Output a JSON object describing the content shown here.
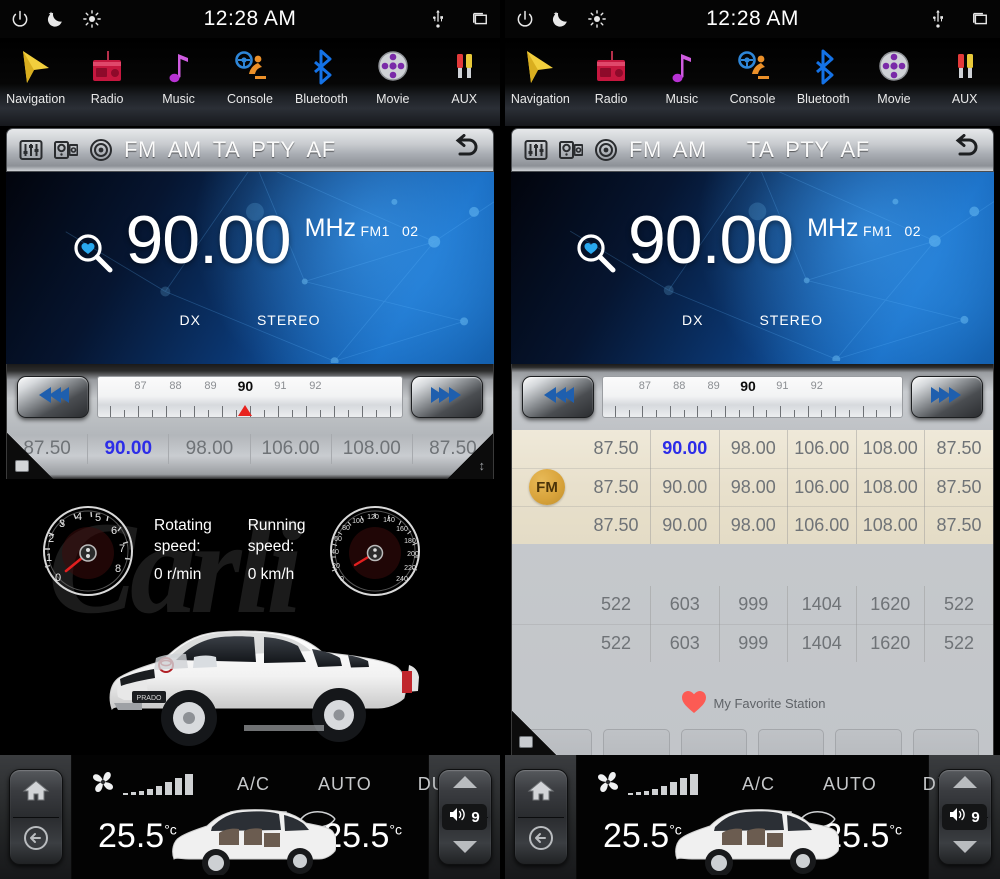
{
  "statusbar": {
    "time": "12:28 AM",
    "left_icons": [
      "power-icon",
      "moon-icon",
      "brightness-icon"
    ],
    "right_icons": [
      "usb-icon",
      "windows-icon"
    ]
  },
  "navbar": {
    "items": [
      {
        "label": "Navigation",
        "icon": "navigation-arrow-icon"
      },
      {
        "label": "Radio",
        "icon": "radio-icon"
      },
      {
        "label": "Music",
        "icon": "music-note-icon"
      },
      {
        "label": "Console",
        "icon": "driving-console-icon"
      },
      {
        "label": "Bluetooth",
        "icon": "bluetooth-icon"
      },
      {
        "label": "Movie",
        "icon": "film-reel-icon"
      },
      {
        "label": "AUX",
        "icon": "aux-plugs-icon"
      }
    ]
  },
  "toolbar": {
    "eq_icon": "equalizer-icon",
    "speaker_icon": "speaker-balance-icon",
    "loud_icon": "loudness-target-icon",
    "fm": "FM",
    "am": "AM",
    "ta": "TA",
    "pty": "PTY",
    "af": "AF",
    "back_icon": "back-arrow-icon"
  },
  "display": {
    "search_icon": "search-heart-icon",
    "frequency": "90.00",
    "unit": "MHz",
    "band": "FM1",
    "preset_no": "02",
    "dx": "DX",
    "stereo": "STEREO"
  },
  "tuner": {
    "prev_icon": "seek-down-icon",
    "next_icon": "seek-up-icon",
    "scale_labels": [
      "87",
      "88",
      "89",
      "90",
      "91",
      "92"
    ],
    "current_scale_label": "90",
    "marker_value": "90"
  },
  "presets_strip": {
    "values": [
      "87.50",
      "90.00",
      "98.00",
      "106.00",
      "108.00",
      "87.50"
    ],
    "active_index": 1
  },
  "gauges": {
    "tach": {
      "caption_line1": "Rotating",
      "caption_line2": "speed:",
      "value": "0 r/min",
      "ticks": [
        "0",
        "1",
        "2",
        "3",
        "4",
        "5",
        "6",
        "7",
        "8"
      ]
    },
    "speedo": {
      "caption_line1": "Running",
      "caption_line2": "speed:",
      "value": "0 km/h",
      "ticks": [
        "0",
        "20",
        "40",
        "60",
        "80",
        "100",
        "120",
        "140",
        "160",
        "180",
        "200",
        "220",
        "240"
      ]
    },
    "watermark": "Carli"
  },
  "fm_presets": {
    "badge": "FM",
    "rows": [
      [
        "87.50",
        "90.00",
        "98.00",
        "106.00",
        "108.00",
        "87.50"
      ],
      [
        "87.50",
        "90.00",
        "98.00",
        "106.00",
        "108.00",
        "87.50"
      ],
      [
        "87.50",
        "90.00",
        "98.00",
        "106.00",
        "108.00",
        "87.50"
      ]
    ],
    "active_row": 0,
    "active_col": 1
  },
  "am_presets": {
    "rows": [
      [
        "522",
        "603",
        "999",
        "1404",
        "1620",
        "522"
      ],
      [
        "522",
        "603",
        "999",
        "1404",
        "1620",
        "522"
      ]
    ]
  },
  "favorites": {
    "heart_icon": "heart-icon",
    "label": "My Favorite Station",
    "slots": [
      "",
      "",
      "",
      "",
      "",
      ""
    ]
  },
  "climate": {
    "fan_icon": "fan-icon",
    "ac": "A/C",
    "auto": "AUTO",
    "dual": "DUAL",
    "rear_defrost_icon": "rear-defrost-icon",
    "front_defrost_icon": "front-defrost-icon",
    "recirculate_icon": "recirculate-air-icon",
    "fresh_air_icon": "fresh-air-icon",
    "temp_left": "25.5",
    "temp_right": "25.5",
    "temp_unit": "°c"
  },
  "hardkeys": {
    "home_icon": "home-icon",
    "back_icon": "back-circle-icon",
    "volume_up_icon": "chevron-up-icon",
    "volume_down_icon": "chevron-down-icon",
    "volume_icon": "volume-icon",
    "volume_value": "9"
  },
  "colors": {
    "accent_blue": "#2c2ce8",
    "marker_red": "#e8231f",
    "fm_badge": "#d9a43c",
    "heart_red": "#fc5b54"
  }
}
